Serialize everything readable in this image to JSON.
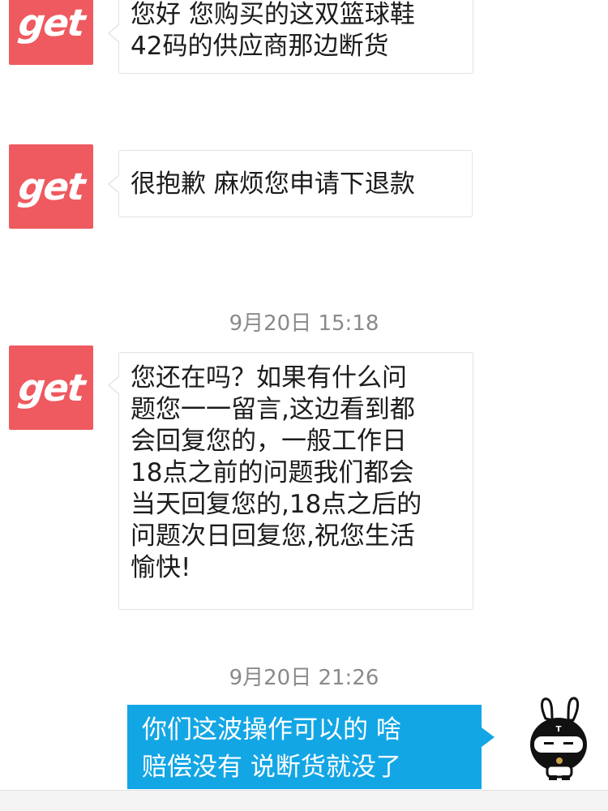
{
  "messages": [
    {
      "sender": "seller",
      "avatar_text": "get",
      "lines": [
        "您好 您购买的这双篮球鞋",
        "42码的供应商那边断货"
      ]
    },
    {
      "sender": "seller",
      "avatar_text": "get",
      "lines": [
        "很抱歉  麻烦您申请下退款"
      ]
    },
    {
      "timestamp": "9月20日 15:18"
    },
    {
      "sender": "seller",
      "avatar_text": "get",
      "lines": [
        "您还在吗？如果有什么问",
        "题您一一留言,这边看到都",
        "会回复您的，一般工作日",
        "18点之前的问题我们都会",
        "当天回复您的,18点之后的",
        "问题次日回复您,祝您生活",
        "愉快!"
      ]
    },
    {
      "timestamp": "9月20日 21:26"
    },
    {
      "sender": "me",
      "lines": [
        "你们这波操作可以的  啥",
        "赔偿没有  说断货就没了"
      ]
    }
  ],
  "colors": {
    "seller_avatar": "#ee5a60",
    "my_bubble": "#13a6e5",
    "timestamp_text": "#8a8a8a"
  },
  "icons": {
    "user_avatar": "rabbit-avatar-icon"
  }
}
